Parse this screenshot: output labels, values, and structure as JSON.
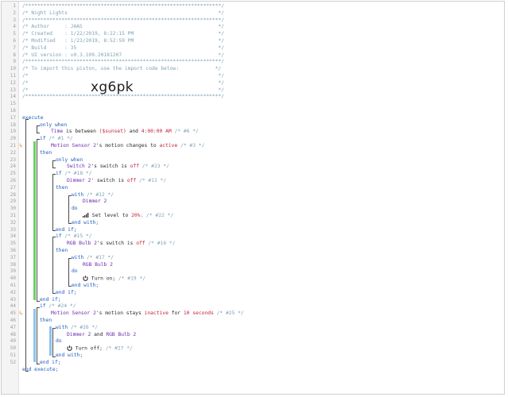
{
  "header": [
    "/*****************************************************************/",
    "/* Night Lights                                                  */",
    "/*****************************************************************/",
    "/* Author     : JAAS                                             */",
    "/* Created    : 1/22/2019, 8:22:15 PM                            */",
    "/* Modified   : 1/23/2019, 8:52:59 PM                            */",
    "/* Build      : 35                                               */",
    "/* UI version : v0.3.109.20181207                                */",
    "/*****************************************************************/",
    "/* To import this piston, use the import code below:            */",
    "/*                                                               */",
    "/*                                                               */",
    "/*                                                               */",
    "/*****************************************************************/"
  ],
  "import_code": "xg6pk",
  "line_numbers": [
    "1",
    "2",
    "3",
    "4",
    "5",
    "6",
    "7",
    "8",
    "9",
    "10",
    "11",
    "12",
    "13",
    "14",
    "15",
    "16",
    "17",
    "18",
    "19",
    "20",
    "21",
    "22",
    "23",
    "24",
    "25",
    "26",
    "27",
    "28",
    "29",
    "30",
    "31",
    "32",
    "33",
    "34",
    "35",
    "36",
    "37",
    "38",
    "39",
    "40",
    "41",
    "42",
    "43",
    "44",
    "45",
    "46",
    "47",
    "48",
    "49",
    "50",
    "51",
    "52"
  ],
  "code": {
    "execute": "execute",
    "only_when": "only when",
    "l18a": "Time",
    "l18b": " is between ",
    "l18c": "($sunset)",
    "l18d": " and ",
    "l18e": "4:00:00 AM",
    "l18f": " /* #6 */",
    "if": "if",
    "c1": " /* #1 */",
    "l20a": "Motion Sensor 2",
    "l20b": "'s motion changes to ",
    "l20c": "active",
    "l20d": " /* #3 */",
    "then": "then",
    "l23a": "Switch 2",
    "l23b": "'s switch is ",
    "l23c": "off",
    "l23d": " /* #23 */",
    "c18": " /* #18 */",
    "l25a": "Dimmer 2'",
    "l25b": " switch is ",
    "l25c": "off",
    "l25d": " /* #11 */",
    "with": "with",
    "c12": " /* #12 */",
    "dimmer2": "Dimmer 2",
    "do": "do",
    "l30a": "Set level to ",
    "l30b": "20%",
    "l30c": "; /* #22 */",
    "end_with": "end with;",
    "end_if": "end if;",
    "c15": " /* #15 */",
    "l34a": "RGB Bulb 2",
    "l34b": "'s switch is ",
    "l34c": "off",
    "l34d": " /* #16 */",
    "c17": " /* #17 */",
    "rgbbulb2": "RGB Bulb 2",
    "l39a": "Turn on;",
    "l39b": " /* #19 */",
    "c24": " /* #24 */",
    "l44a": "Motion Sensor 2",
    "l44b": "'s motion stays ",
    "l44c": "inactive",
    "l44d": " for ",
    "l44e": "10 seconds",
    "l44f": " /* #25 */",
    "c26": " /* #26 */",
    "l47a": "Dimmer 2",
    "l47b": " and ",
    "l47c": "RGB Bulb 2",
    "l49a": "Turn off;",
    "l49b": " /* #27 */",
    "end_execute": "end execute;"
  }
}
